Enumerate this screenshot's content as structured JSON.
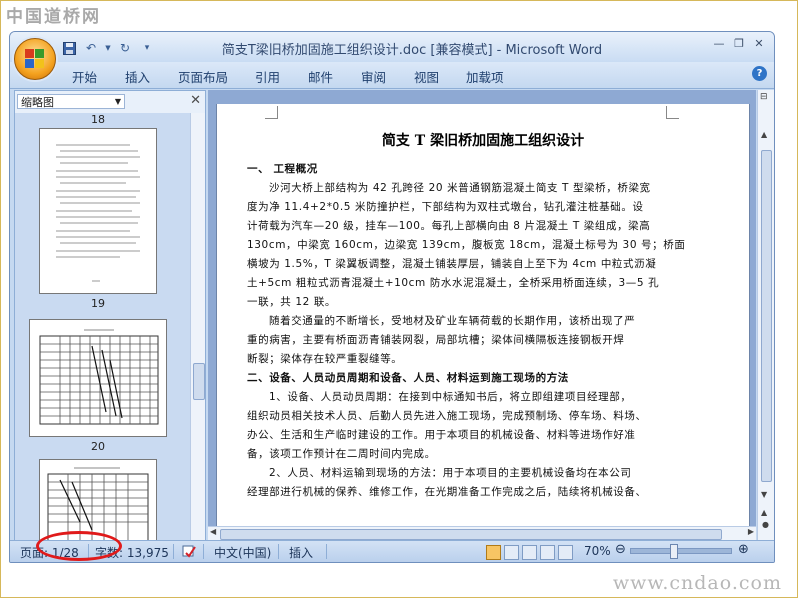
{
  "watermarks": {
    "top": "中国道桥网",
    "bottom": "www.cndao.com"
  },
  "window": {
    "title": "简支T梁旧桥加固施工组织设计.doc [兼容模式] - Microsoft Word"
  },
  "quick_access": [
    "save-icon",
    "undo-icon",
    "redo-icon",
    "customize-icon"
  ],
  "ribbon_tabs": [
    "开始",
    "插入",
    "页面布局",
    "引用",
    "邮件",
    "审阅",
    "视图",
    "加载项"
  ],
  "nav_pane": {
    "view_select": "缩略图",
    "thumbnails": [
      {
        "page": "18"
      },
      {
        "page": "19"
      },
      {
        "page": "20"
      }
    ]
  },
  "document": {
    "title": "简支 T 梁旧桥加固施工组织设计",
    "lines": [
      "一、 工程概况",
      "沙河大桥上部结构为 42 孔跨径 20 米普通钢筋混凝土简支 T 型梁桥，桥梁宽",
      "度为净 11.4+2*0.5 米防撞护栏，下部结构为双柱式墩台，钻孔灌注桩基础。设",
      "计荷载为汽车—20 级，挂车—100。每孔上部横向由 8 片混凝土 T 梁组成，梁高",
      "130cm，中梁宽 160cm，边梁宽 139cm，腹板宽 18cm，混凝土标号为 30 号；桥面",
      "横坡为 1.5%，T 梁翼板调整，混凝土铺装厚层，铺装自上至下为 4cm 中粒式沥凝",
      "土+5cm 粗粒式沥青混凝土+10cm 防水水泥混凝土，全桥采用桥面连续，3—5 孔",
      "一联，共 12 联。",
      "随着交通量的不断增长，受地材及矿业车辆荷载的长期作用，该桥出现了严",
      "重的病害，主要有桥面沥青铺装网裂，局部坑槽；梁体间横隔板连接钢板开焊",
      "断裂；梁体存在较严重裂缝等。",
      "二、设备、人员动员周期和设备、人员、材料运到施工现场的方法",
      "1、设备、人员动员周期：在接到中标通知书后，将立即组建项目经理部，",
      "组织动员相关技术人员、后勤人员先进入施工现场，完成预制场、停车场、料场、",
      "办公、生活和生产临时建设的工作。用于本项目的机械设备、材料等进场作好准",
      "备，该项工作预计在二周时间内完成。",
      "2、人员、材料运输到现场的方法：用于本项目的主要机械设备均在本公司",
      "经理部进行机械的保养、维修工作，在光期准备工作完成之后，陆续将机械设备、"
    ]
  },
  "statusbar": {
    "page": "页面: 1/28",
    "words": "字数: 13,975",
    "language": "中文(中国)",
    "mode": "插入",
    "zoom": "70%",
    "zoom_percent": 70
  },
  "colors": {
    "annotation": "#e01a1a",
    "titlebar": "#c9dcf3",
    "accent": "#2f74c7"
  }
}
